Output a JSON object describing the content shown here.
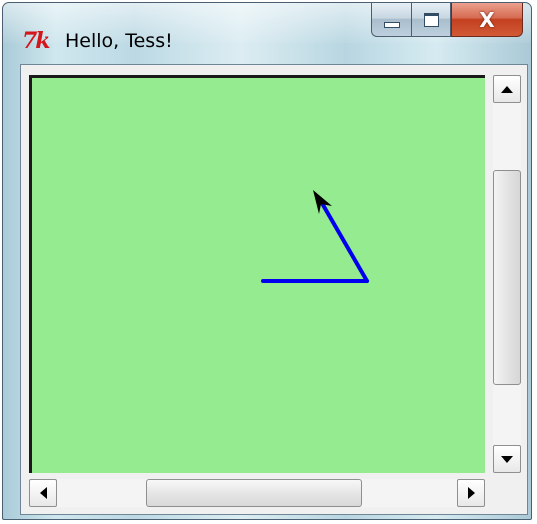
{
  "window": {
    "title": "Hello, Tess!",
    "icon": "tk-feather-icon",
    "icon_text": "7k",
    "buttons": {
      "minimize": "minimize-icon",
      "maximize": "maximize-icon",
      "close_label": "X"
    }
  },
  "canvas": {
    "background": "#95eb8f",
    "line_color": "#0000ee",
    "cursor_color": "#000000"
  },
  "scrollbars": {
    "vertical": {
      "thumb_fraction_start": 0.24,
      "thumb_fraction_size": 0.54
    },
    "horizontal": {
      "thumb_fraction_start": 0.26,
      "thumb_fraction_size": 0.47
    }
  }
}
